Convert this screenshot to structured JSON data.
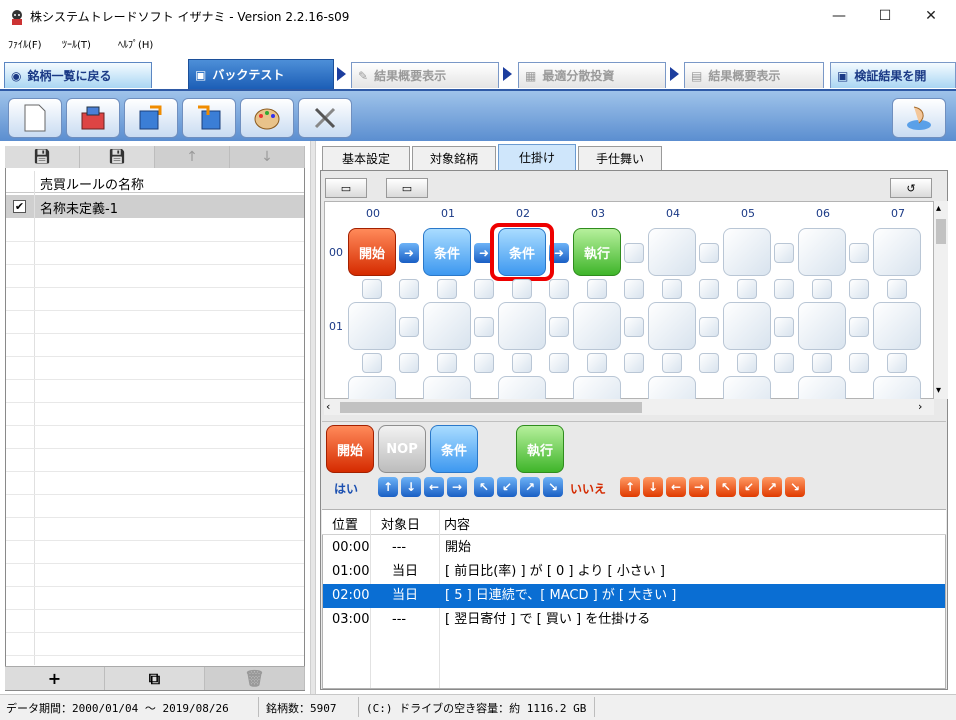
{
  "window": {
    "title": "株システムトレードソフト イザナミ - Version 2.2.16-s09",
    "min": "—",
    "max": "☐",
    "close": "✕"
  },
  "menu": [
    "ﾌｧｲﾙ(F)",
    "ﾂｰﾙ(T)",
    "ﾍﾙﾌﾟ(H)"
  ],
  "main_tabs": {
    "home": "銘柄一覧に戻る",
    "backtest": "バックテスト",
    "summary1": "結果概要表示",
    "dist": "最適分散投資",
    "summary2": "結果概要表示",
    "verify": "検証結果を開"
  },
  "left": {
    "header": "売買ルールの名称",
    "rule_name": "名称未定義-1",
    "checked": "✔"
  },
  "sub_tabs": [
    "基本設定",
    "対象銘柄",
    "仕掛け",
    "手仕舞い"
  ],
  "grid": {
    "cols": [
      "00",
      "01",
      "02",
      "03",
      "04",
      "05",
      "06",
      "07"
    ],
    "rows": [
      "00",
      "01"
    ],
    "nodes": {
      "start": "開始",
      "cond1": "条件",
      "cond2": "条件",
      "exec": "執行"
    }
  },
  "palette": {
    "start": "開始",
    "nop": "NOP",
    "cond": "条件",
    "exec": "執行",
    "yes": "はい",
    "no": "いいえ",
    "yes_arrows": [
      "↑",
      "↓",
      "←",
      "→",
      "↖",
      "↙",
      "↗",
      "↘"
    ],
    "no_arrows": [
      "↑",
      "↓",
      "←",
      "→",
      "↖",
      "↙",
      "↗",
      "↘"
    ]
  },
  "list": {
    "headers": [
      "位置",
      "対象日",
      "内容"
    ],
    "rows": [
      {
        "pos": "00:00",
        "day": "---",
        "content": "開始"
      },
      {
        "pos": "01:00",
        "day": "当日",
        "content": "[ 前日比(率) ] が [ 0 ] より [ 小さい ]"
      },
      {
        "pos": "02:00",
        "day": "当日",
        "content": "[ 5 ] 日連続で、[ MACD ] が [ 大きい ]"
      },
      {
        "pos": "03:00",
        "day": "---",
        "content": "[ 翌日寄付 ] で [ 買い ] を仕掛ける"
      }
    ]
  },
  "status": {
    "period": "データ期間：2000/01/04 〜 2019/08/26",
    "count": "銘柄数：5907",
    "drive": "(C:) ドライブの空き容量：約 1116.2 GB"
  },
  "colors": {
    "accent": "#0a6ed3",
    "highlight": "#ee0000"
  }
}
